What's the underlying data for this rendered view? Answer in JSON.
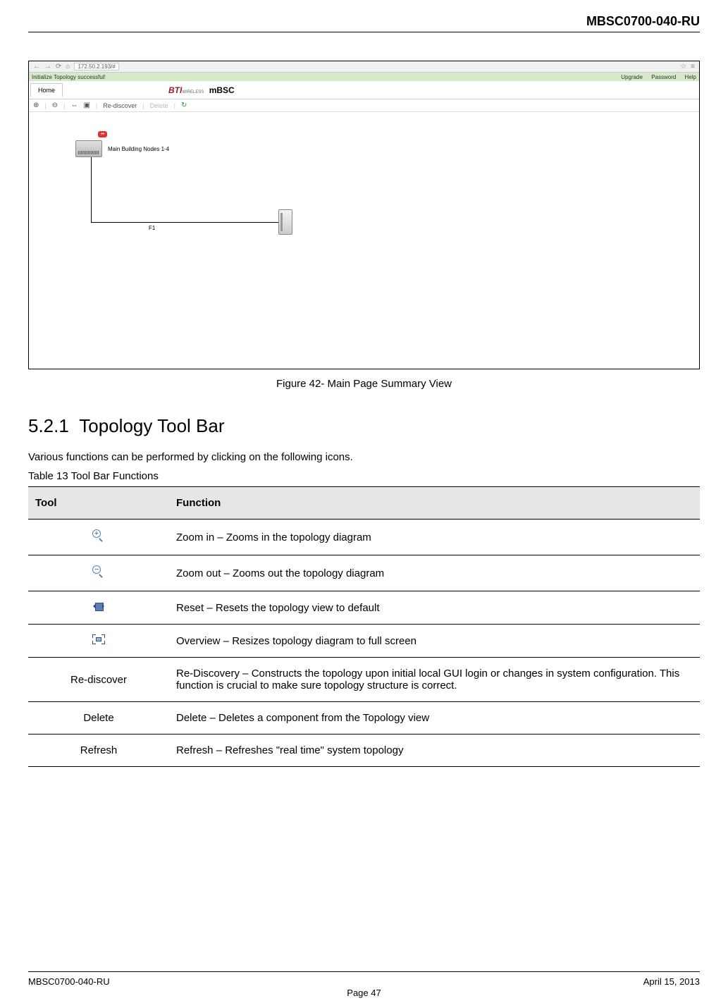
{
  "header": {
    "doc_code": "MBSC0700-040-RU"
  },
  "screenshot": {
    "browser": {
      "url": "172.50.2.193/#",
      "back_icon": "←",
      "fwd_icon": "→",
      "reload_icon": "⟳",
      "home_icon": "⌂",
      "star_icon": "☆",
      "menu_icon": "≡"
    },
    "status_bar": {
      "left": "Initialize Topology successful!",
      "links": [
        "Upgrade",
        "Password",
        "Help"
      ]
    },
    "app_header": {
      "home_tab": "Home",
      "logo_brand": "BTI",
      "logo_sub": "WIRELESS",
      "logo_product": "mBSC"
    },
    "toolbar": {
      "zoom_in": "⊕",
      "zoom_out": "⊖",
      "reset": "⇔",
      "overview": "▣",
      "rediscover": "Re-discover",
      "delete": "Delete",
      "refresh": "↻"
    },
    "topology": {
      "main_node_label": "Main Building Nodes 1-4",
      "alert_text": "••",
      "link_label": "F1"
    }
  },
  "figure_caption": "Figure 42- Main Page Summary View",
  "section": {
    "number": "5.2.1",
    "title": "Topology Tool Bar"
  },
  "section_intro": "Various functions can be performed by clicking on the following icons.",
  "table_caption": "Table 13 Tool Bar Functions",
  "table": {
    "headers": {
      "tool": "Tool",
      "function": "Function"
    },
    "rows": [
      {
        "tool_type": "zoom-in-icon",
        "tool_text": "",
        "function": "Zoom in – Zooms in the topology diagram"
      },
      {
        "tool_type": "zoom-out-icon",
        "tool_text": "",
        "function": "Zoom out – Zooms out the topology diagram"
      },
      {
        "tool_type": "reset-icon",
        "tool_text": "",
        "function": "Reset – Resets the topology view to default"
      },
      {
        "tool_type": "overview-icon",
        "tool_text": "",
        "function": "Overview – Resizes topology diagram to full screen"
      },
      {
        "tool_type": "text",
        "tool_text": "Re-discover",
        "function": "Re-Discovery – Constructs the topology upon initial local GUI login or changes in system configuration. This function is crucial to make sure topology structure is correct."
      },
      {
        "tool_type": "text",
        "tool_text": "Delete",
        "function": "Delete – Deletes a component from the Topology view"
      },
      {
        "tool_type": "text",
        "tool_text": "Refresh",
        "function": "Refresh – Refreshes \"real time\" system topology"
      }
    ]
  },
  "footer": {
    "left": "MBSC0700-040-RU",
    "right": "April 15, 2013",
    "center": "Page 47"
  }
}
